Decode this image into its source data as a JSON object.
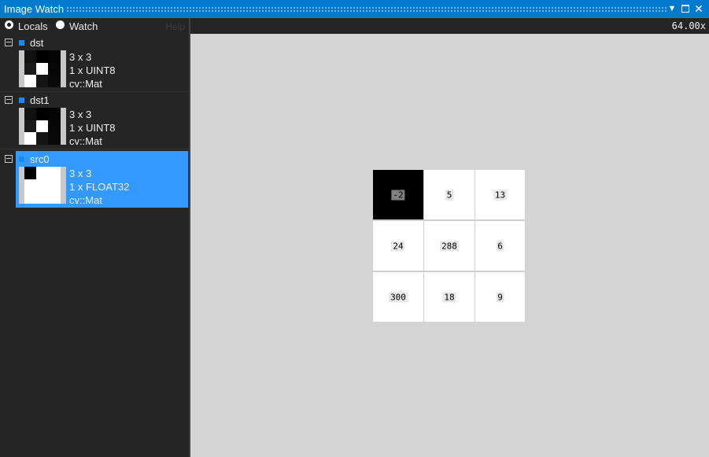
{
  "window": {
    "title": "Image Watch",
    "colors": {
      "accent": "#007acc",
      "selection": "#3399ff",
      "panel": "#252526",
      "canvas": "#d4d4d4"
    }
  },
  "toolbar": {
    "locals_label": "Locals",
    "watch_label": "Watch",
    "help_label": "Help",
    "selected_mode": "Locals"
  },
  "variables": [
    {
      "name": "dst",
      "dims": "3 x 3",
      "type": "1 x UINT8",
      "class": "cv::Mat",
      "selected": false
    },
    {
      "name": "dst1",
      "dims": "3 x 3",
      "type": "1 x UINT8",
      "class": "cv::Mat",
      "selected": false
    },
    {
      "name": "src0",
      "dims": "3 x 3",
      "type": "1 x FLOAT32",
      "class": "cv::Mat",
      "selected": true
    }
  ],
  "viewer": {
    "zoom": "64.00x",
    "pixels": [
      [
        "-2",
        "5",
        "13"
      ],
      [
        "24",
        "288",
        "6"
      ],
      [
        "300",
        "18",
        "9"
      ]
    ]
  }
}
